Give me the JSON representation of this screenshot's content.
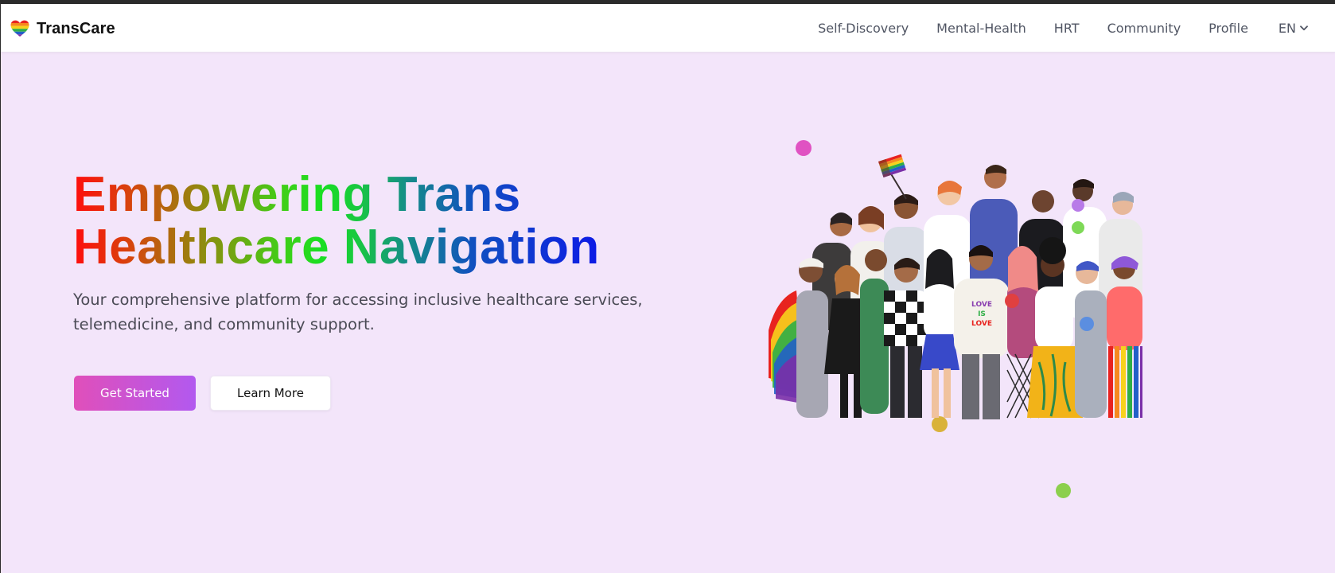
{
  "nav": {
    "brand": "TransCare",
    "links": [
      "Self-Discovery",
      "Mental-Health",
      "HRT",
      "Community",
      "Profile"
    ],
    "language": "EN"
  },
  "hero": {
    "title_line1": "Empowering Trans",
    "title_line2": "Healthcare Navigation",
    "subtitle_line1": "Your comprehensive platform for accessing inclusive healthcare services,",
    "subtitle_line2": "telemedicine, and community support.",
    "primary_button": "Get Started",
    "secondary_button": "Learn More",
    "illustration": {
      "shirt_text": [
        "LOVE",
        "IS",
        "LOVE"
      ]
    }
  },
  "colors": {
    "background": "#f3e5fa",
    "navbar": "#ffffff",
    "button_gradient_start": "#e04fba",
    "button_gradient_end": "#b259ef",
    "dots": [
      "#e052c2",
      "#b87be8",
      "#7ed957",
      "#e04040",
      "#5b8ee0",
      "#4cc9d6",
      "#d9b23a",
      "#8ccf4d"
    ]
  },
  "icons": {
    "brand": "rainbow-heart-icon",
    "language": "chevron-down-icon"
  }
}
